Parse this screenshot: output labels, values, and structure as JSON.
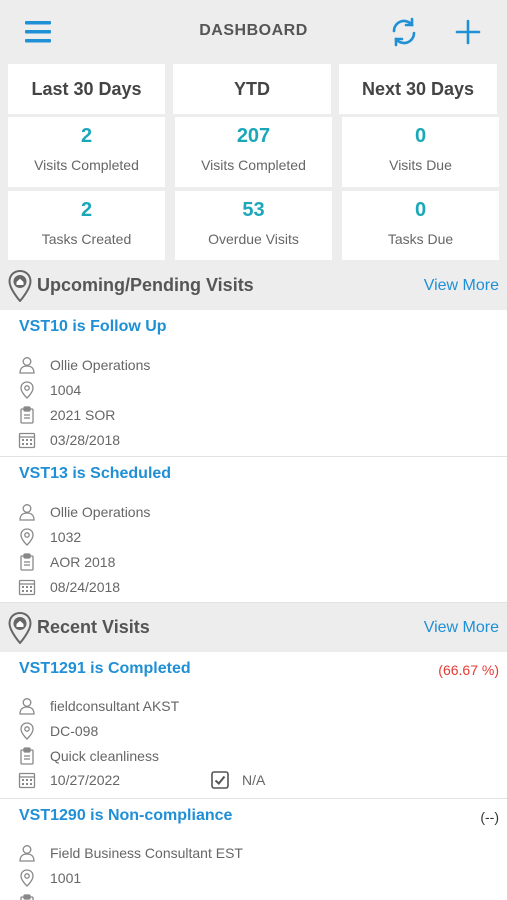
{
  "header": {
    "title": "DASHBOARD",
    "menu_icon": "hamburger-menu-icon",
    "refresh_icon": "refresh-icon",
    "add_icon": "plus-icon",
    "accent": "#1f8fd6"
  },
  "periods": [
    "Last 30 Days",
    "YTD",
    "Next 30 Days"
  ],
  "stats": [
    {
      "value": "2",
      "label": "Visits Completed"
    },
    {
      "value": "207",
      "label": "Visits Completed"
    },
    {
      "value": "0",
      "label": "Visits Due"
    },
    {
      "value": "2",
      "label": "Tasks Created"
    },
    {
      "value": "53",
      "label": "Overdue Visits"
    },
    {
      "value": "0",
      "label": "Tasks Due"
    }
  ],
  "stat_color": "#1aa8b8",
  "upcoming": {
    "title": "Upcoming/Pending Visits",
    "view_more": "View More",
    "visits": [
      {
        "title": "VST10 is Follow Up",
        "person": "Ollie Operations",
        "location": "1004",
        "form": "2021 SOR",
        "date": "03/28/2018"
      },
      {
        "title": "VST13 is Scheduled",
        "person": "Ollie Operations",
        "location": "1032",
        "form": "AOR 2018",
        "date": "08/24/2018"
      }
    ]
  },
  "recent": {
    "title": "Recent Visits",
    "view_more": "View More",
    "visits": [
      {
        "title": "VST1291 is Completed",
        "score": "(66.67 %)",
        "score_color": "#e53935",
        "person": "fieldconsultant AKST",
        "location": "DC-098",
        "form": "Quick cleanliness",
        "date": "10/27/2022",
        "check_label": "N/A"
      },
      {
        "title": "VST1290 is Non-compliance",
        "score": "(--)",
        "score_color": "#333333",
        "person": "Field Business Consultant EST",
        "location": "1001"
      }
    ]
  }
}
